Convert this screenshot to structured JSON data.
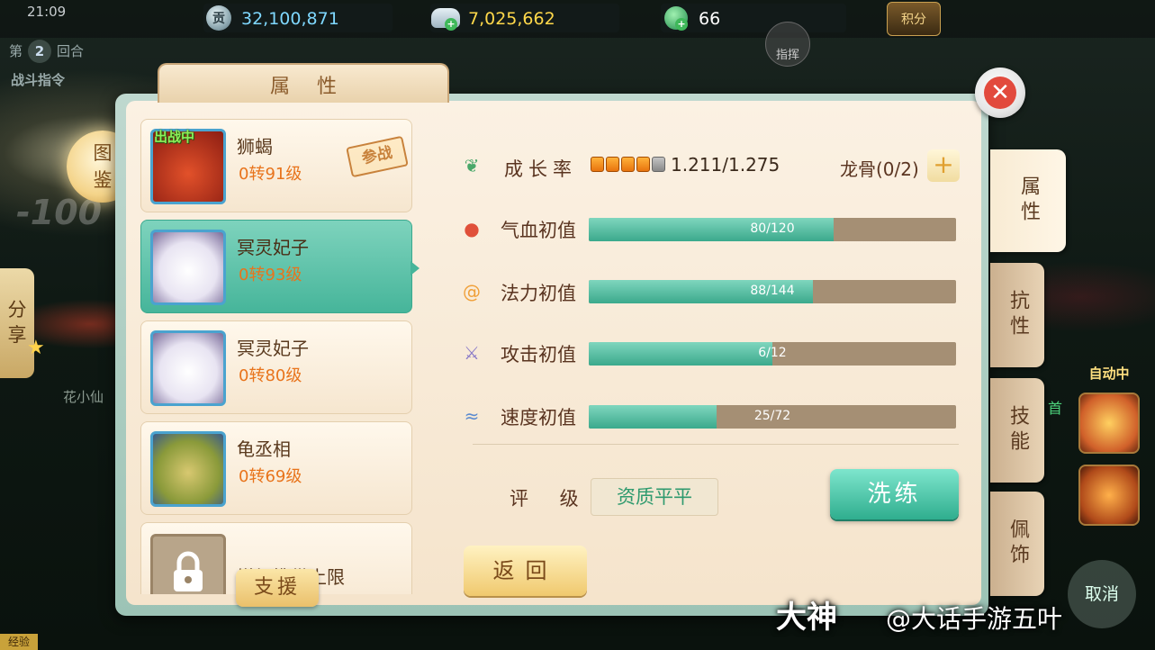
{
  "status": {
    "time": "21:09"
  },
  "resources": {
    "contribution": {
      "icon": "contribution-coin-icon",
      "glyph": "贡",
      "value": "32,100,871"
    },
    "silver": {
      "icon": "silver-ingot-icon",
      "value": "7,025,662"
    },
    "jade": {
      "icon": "jade-icon",
      "value": "66"
    },
    "points": {
      "label": "积分"
    }
  },
  "battle": {
    "round_prefix": "第",
    "round_number": "2",
    "round_suffix": "回合",
    "command_label": "战斗指令",
    "command_button": "指挥",
    "damage_text": "-100"
  },
  "side_left": {
    "codex": "图鉴",
    "share": "分享",
    "ally_name": "花小仙"
  },
  "panel": {
    "title": "属性",
    "pets": [
      {
        "name": "狮蝎",
        "level": "0转91级",
        "badge": "出战中",
        "stamp": "参战",
        "selected": false
      },
      {
        "name": "冥灵妃子",
        "level": "0转93级",
        "selected": true
      },
      {
        "name": "冥灵妃子",
        "level": "0转80级",
        "selected": false
      },
      {
        "name": "龟丞相",
        "level": "0转69级",
        "selected": false
      },
      {
        "name": "增加携带上限",
        "locked": true
      }
    ],
    "support_button": "支援",
    "stats": {
      "growth": {
        "label": "成长率",
        "value": "1.211/1.275",
        "filled": 4,
        "total": 5
      },
      "dragon_bone": {
        "label": "龙骨(0/2)",
        "plus": "+"
      },
      "bars": [
        {
          "label": "气血初值",
          "text": "80/120",
          "fraction": 0.6667,
          "icon": "blood-drop-icon"
        },
        {
          "label": "法力初值",
          "text": "88/144",
          "fraction": 0.6111,
          "icon": "mana-swirl-icon"
        },
        {
          "label": "攻击初值",
          "text": "6/12",
          "fraction": 0.5,
          "icon": "sword-icon"
        },
        {
          "label": "速度初值",
          "text": "25/72",
          "fraction": 0.3472,
          "icon": "wind-icon"
        }
      ],
      "rating_label": "评 级",
      "rating_value": "资质平平"
    },
    "wash_button": "洗练",
    "back_button": "返回",
    "tabs": [
      "属性",
      "抗性",
      "技能",
      "佩饰"
    ]
  },
  "right_side": {
    "auto_label": "自动中",
    "cancel_label": "取消",
    "first_label": "首"
  },
  "watermark": {
    "brand": "大神",
    "account": "@大话手游五叶"
  },
  "exp_label": "经验",
  "colors": {
    "accent_teal": "#46b59a",
    "level_orange": "#e8741c",
    "rating_green": "#2e9a6e"
  }
}
